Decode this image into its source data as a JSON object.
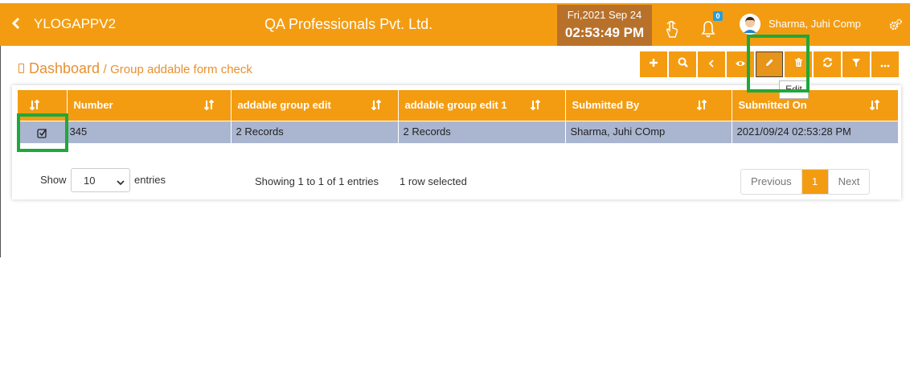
{
  "header": {
    "app_name": "YLOGAPPV2",
    "company": "QA Professionals Pvt. Ltd.",
    "date": "Fri,2021 Sep 24",
    "time": "02:53:49 PM",
    "notification_count": "0",
    "user_name": "Sharma, Juhi Comp",
    "icons": [
      "back-chevron-icon",
      "touch-icon",
      "bell-icon",
      "avatar",
      "gears-icon"
    ]
  },
  "breadcrumb": {
    "main": "Dashboard",
    "separator": "/",
    "sub": "Group addable form check"
  },
  "toolbar": {
    "buttons": [
      "add-icon",
      "search-icon",
      "back-icon",
      "view-icon",
      "edit-icon",
      "delete-icon",
      "refresh-icon",
      "filter-icon",
      "more-icon"
    ],
    "tooltip": "Edit"
  },
  "table": {
    "columns": [
      "Number",
      "addable group edit",
      "addable group edit 1",
      "Submitted By",
      "Submitted On"
    ],
    "rows": [
      [
        "345",
        "2 Records",
        "2 Records",
        "Sharma, Juhi COmp",
        "2021/09/24 02:53:28 PM"
      ]
    ]
  },
  "footer": {
    "show_label": "Show",
    "page_size": "10",
    "entries_label": "entries",
    "info_prefix": "Showing ",
    "info_from": "1",
    "info_to_word": " to ",
    "info_to": "1",
    "info_of_word": " of ",
    "info_total": "1",
    "info_suffix": " entries",
    "selected_info": "1 row selected",
    "previous": "Previous",
    "current_page": "1",
    "next": "Next"
  },
  "colors": {
    "accent": "#f39c12",
    "clock_bg": "#b8712b",
    "selected_row": "#aab5d0",
    "highlight_box": "#1fa83a"
  }
}
